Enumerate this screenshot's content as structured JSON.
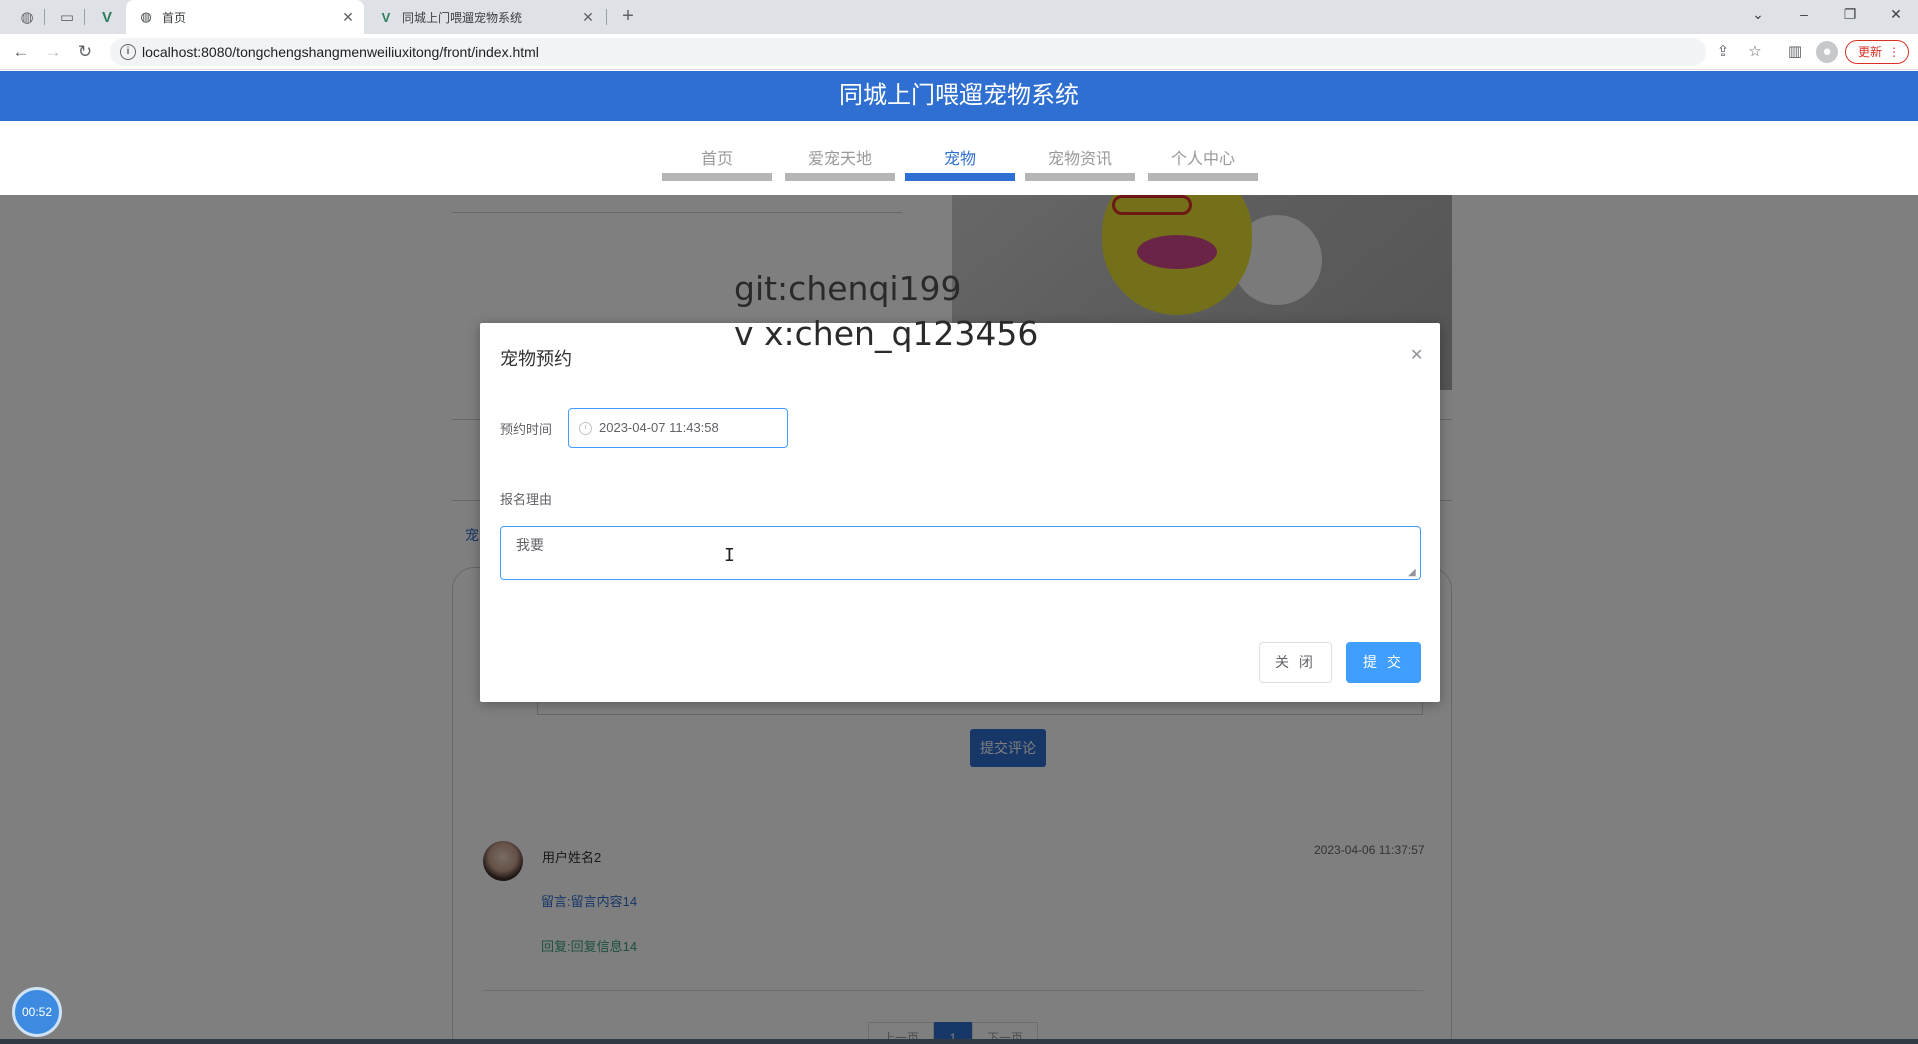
{
  "browser": {
    "tabs": [
      {
        "label": "首页",
        "active": true
      },
      {
        "label": "同城上门喂遛宠物系统",
        "active": false
      }
    ],
    "url": "localhost:8080/tongchengshangmenweiliuxitong/front/index.html",
    "update_label": "更新"
  },
  "site": {
    "title": "同城上门喂遛宠物系统",
    "nav": [
      {
        "label": "首页",
        "active": false
      },
      {
        "label": "爱宠天地",
        "active": false
      },
      {
        "label": "宠物",
        "active": true
      },
      {
        "label": "宠物资讯",
        "active": false
      },
      {
        "label": "个人中心",
        "active": false
      }
    ]
  },
  "watermark": {
    "line1": "git:chenqi199",
    "line2": "v x:chen_q123456"
  },
  "dialog": {
    "title": "宠物预约",
    "time_label": "预约时间",
    "time_value": "2023-04-07 11:43:58",
    "reason_label": "报名理由",
    "reason_value": "我要",
    "close_label": "关 闭",
    "submit_label": "提 交"
  },
  "comments": {
    "side_link": "宠",
    "submit_label": "提交评论",
    "items": [
      {
        "user": "用户姓名2",
        "time": "2023-04-06 11:37:57",
        "message": "留言:留言内容14",
        "reply": "回复:回复信息14"
      }
    ],
    "pager": {
      "prev": "上一页",
      "current": "1",
      "next": "下一页"
    }
  },
  "timer": "00:52",
  "colors": {
    "brand": "#2f6fd2",
    "dialog_accent": "#409eff"
  }
}
